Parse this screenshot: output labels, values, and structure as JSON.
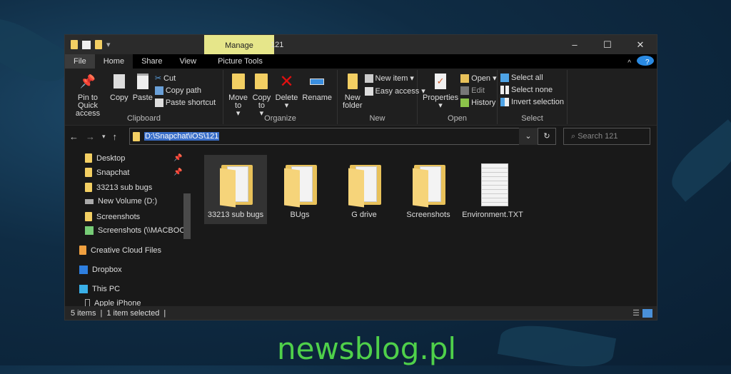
{
  "window": {
    "title": "121",
    "context_tab": "Manage",
    "controls": [
      "–",
      "☐",
      "✕"
    ]
  },
  "tabs": [
    {
      "label": "File"
    },
    {
      "label": "Home"
    },
    {
      "label": "Share"
    },
    {
      "label": "View"
    },
    {
      "label": "Picture Tools"
    }
  ],
  "ribbon": {
    "clipboard": {
      "label": "Clipboard",
      "pin": "Pin to Quick access",
      "copy": "Copy",
      "paste": "Paste",
      "cut": "Cut",
      "copy_path": "Copy path",
      "paste_shortcut": "Paste shortcut"
    },
    "organize": {
      "label": "Organize",
      "move_to": "Move to",
      "copy_to": "Copy to",
      "delete": "Delete",
      "rename": "Rename"
    },
    "new": {
      "label": "New",
      "new_folder": "New folder",
      "new_item": "New item",
      "easy_access": "Easy access"
    },
    "open": {
      "label": "Open",
      "properties": "Properties",
      "open": "Open",
      "edit": "Edit",
      "history": "History"
    },
    "select": {
      "label": "Select",
      "select_all": "Select all",
      "select_none": "Select none",
      "invert": "Invert selection"
    }
  },
  "address": {
    "path": "D:\\Snapchat\\iOS\\121",
    "search_placeholder": "Search 121"
  },
  "sidebar": [
    {
      "label": "Desktop",
      "pinned": true
    },
    {
      "label": "Snapchat",
      "pinned": true
    },
    {
      "label": "33213 sub bugs"
    },
    {
      "label": "New Volume (D:)"
    },
    {
      "label": "Screenshots"
    },
    {
      "label": "Screenshots (\\\\MACBOOK"
    },
    {
      "label": "Creative Cloud Files"
    },
    {
      "label": "Dropbox"
    },
    {
      "label": "This PC"
    },
    {
      "label": "Apple iPhone"
    }
  ],
  "files": [
    {
      "name": "33213 sub bugs",
      "type": "folder",
      "selected": true
    },
    {
      "name": "BUgs",
      "type": "folder"
    },
    {
      "name": "G drive",
      "type": "folder"
    },
    {
      "name": "Screenshots",
      "type": "folder"
    },
    {
      "name": "Environment.TXT",
      "type": "text"
    }
  ],
  "status": {
    "count": "5 items",
    "selected": "1 item selected"
  },
  "watermark": "newsblog.pl"
}
